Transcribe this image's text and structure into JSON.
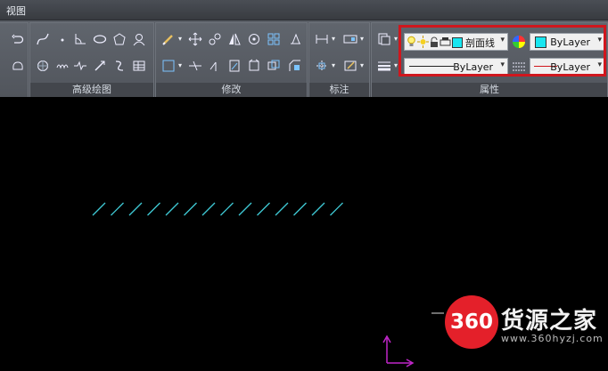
{
  "menubar": {
    "tab_view": "视图"
  },
  "panels": {
    "advanced_draw": "高级绘图",
    "modify": "修改",
    "annotate": "标注",
    "properties": "属性"
  },
  "properties": {
    "layer_name": "剖面线",
    "color": "ByLayer",
    "linetype": "ByLayer",
    "lineweight": "ByLayer"
  },
  "colors": {
    "hatch_cyan": "#3fc9d4",
    "ucs_magenta": "#c026c9",
    "highlight_red": "#d0161d",
    "layer_color_swatch": "#19e6f0"
  },
  "watermark": {
    "logo": "360",
    "name": "货源之家",
    "url": "www.360hyzj.com"
  }
}
